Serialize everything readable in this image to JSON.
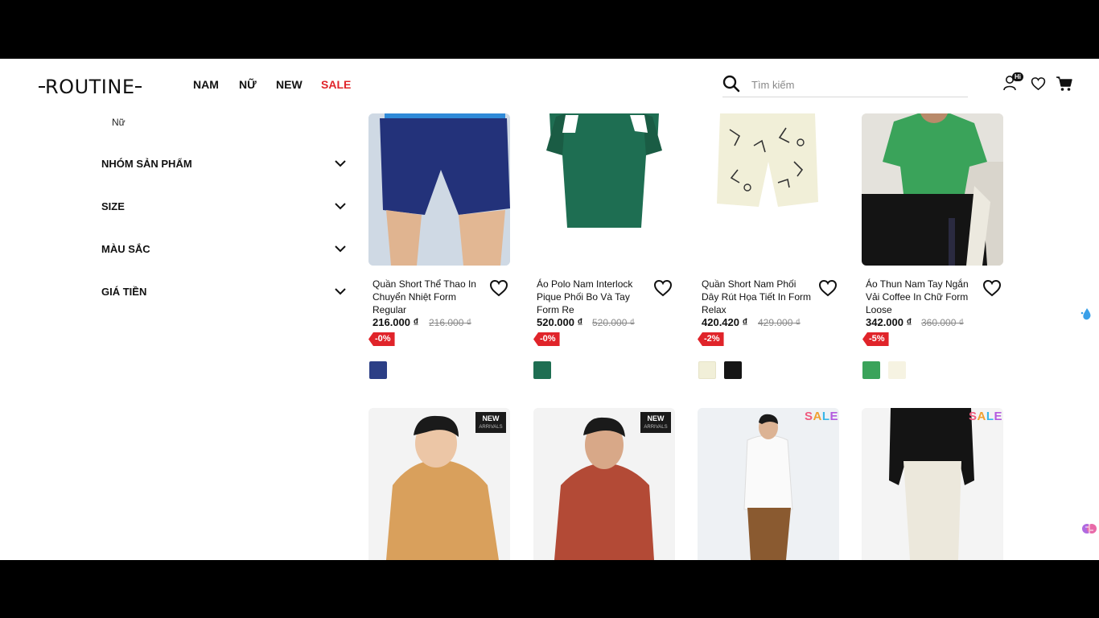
{
  "header": {
    "logo": "ROUTINE",
    "nav": [
      "NAM",
      "NỮ",
      "NEW",
      "SALE"
    ],
    "search_placeholder": "Tìm kiếm",
    "user_badge": "Hi"
  },
  "sidebar": {
    "breadcrumb": "Nữ",
    "filters": [
      "NHÓM SẢN PHẨM",
      "SIZE",
      "MÀU SẮC",
      "GIÁ TIỀN"
    ]
  },
  "products": [
    {
      "name": "Quần Short Thể Thao In Chuyển Nhiệt Form Regular",
      "price": "216.000 ₫",
      "old_price": "216.000 ₫",
      "discount": "-0%",
      "swatches": [
        "#2c3f86"
      ]
    },
    {
      "name": "Áo Polo Nam Interlock Pique Phối Bo Và Tay Form Re",
      "price": "520.000 ₫",
      "old_price": "520.000 ₫",
      "discount": "-0%",
      "swatches": [
        "#1e6e52"
      ]
    },
    {
      "name": "Quần Short Nam Phối Dây Rút Họa Tiết In Form Relax",
      "price": "420.420 ₫",
      "old_price": "429.000 ₫",
      "discount": "-2%",
      "swatches": [
        "#f1efd8",
        "#151515"
      ]
    },
    {
      "name": "Áo Thun Nam Tay Ngắn Vải Coffee In Chữ Form Loose",
      "price": "342.000 ₫",
      "old_price": "360.000 ₫",
      "discount": "-5%",
      "swatches": [
        "#3aa35a",
        "#f6f3e2"
      ]
    }
  ],
  "row2_tags": [
    {
      "type": "new",
      "text": "NEW",
      "sub": "ARRIVALS"
    },
    {
      "type": "new",
      "text": "NEW",
      "sub": "ARRIVALS"
    },
    {
      "type": "sale",
      "text": "SALE"
    },
    {
      "type": "sale",
      "text": "SALE"
    }
  ],
  "colors": {
    "accent_red": "#e0242a",
    "text": "#111111"
  }
}
